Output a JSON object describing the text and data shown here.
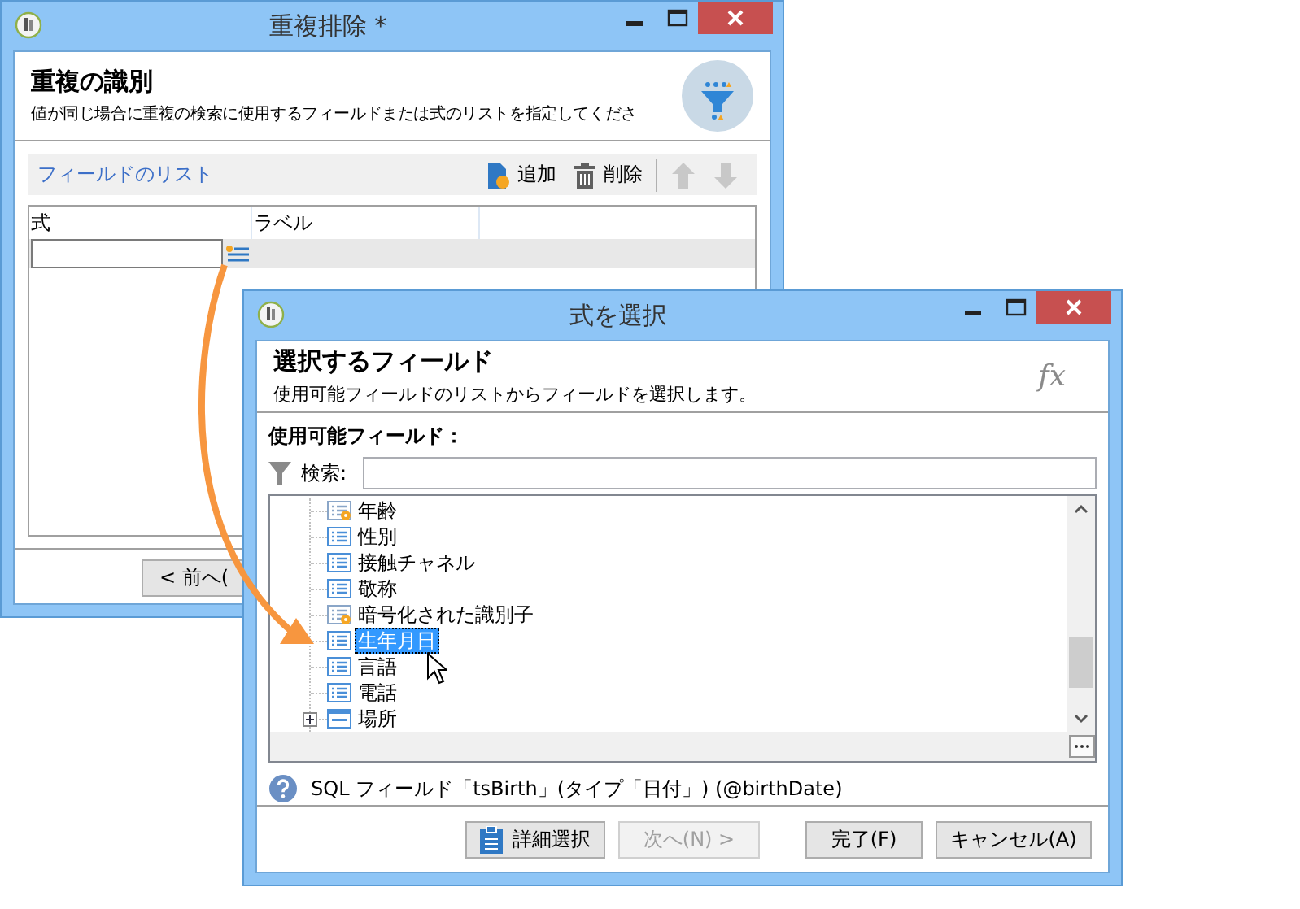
{
  "dedup_window": {
    "title": "重複排除 *",
    "header": {
      "title": "重複の識別",
      "description": "値が同じ場合に重複の検索に使用するフィールドまたは式のリストを指定してくださ"
    },
    "field_list": {
      "title": "フィールドのリスト",
      "toolbar": [
        {
          "kind": "add",
          "label": "追加",
          "disabled": false
        },
        {
          "kind": "delete",
          "label": "削除",
          "disabled": false
        },
        {
          "kind": "up",
          "disabled": true
        },
        {
          "kind": "down",
          "disabled": true
        }
      ]
    },
    "table": {
      "columns": [
        "式",
        "ラベル"
      ]
    },
    "buttons": [
      {
        "label": "< 前へ("
      }
    ]
  },
  "select_window": {
    "title": "式を選択",
    "header": {
      "title": "選択するフィールド",
      "description": "使用可能フィールドのリストからフィールドを選択します。",
      "icon_text": "fx"
    },
    "available_label": "使用可能フィールド：",
    "search": {
      "label": "検索:"
    },
    "tree": [
      {
        "kind": "computed",
        "label": "年齢",
        "selected": false
      },
      {
        "kind": "field",
        "label": "性別",
        "selected": false
      },
      {
        "kind": "field",
        "label": "接触チャネル",
        "selected": false
      },
      {
        "kind": "field",
        "label": "敬称",
        "selected": false
      },
      {
        "kind": "computed",
        "label": "暗号化された識別子",
        "selected": false
      },
      {
        "kind": "field",
        "label": "生年月日",
        "selected": true
      },
      {
        "kind": "field",
        "label": "言語",
        "selected": false
      },
      {
        "kind": "field",
        "label": "電話",
        "selected": false
      },
      {
        "kind": "link",
        "label": "場所",
        "selected": false,
        "expanded": false
      }
    ],
    "info": "SQL フィールド「tsBirth」(タイプ「日付」) (@birthDate)",
    "buttons": [
      {
        "kind": "advanced",
        "label": "詳細選択",
        "disabled": false
      },
      {
        "kind": "plain",
        "label": "次へ(N) >",
        "disabled": true
      },
      {
        "kind": "plain",
        "label": "完了(F)",
        "disabled": false
      },
      {
        "kind": "plain",
        "label": "キャンセル(A)",
        "disabled": false
      }
    ]
  }
}
